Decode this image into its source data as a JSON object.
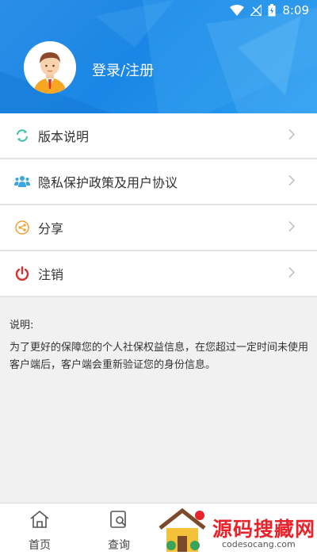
{
  "status_bar": {
    "time": "8:09"
  },
  "header": {
    "login_label": "登录/注册"
  },
  "menu": [
    {
      "label": "版本说明",
      "icon": "refresh-icon",
      "color": "#3bbfa6"
    },
    {
      "label": "隐私保护政策及用户协议",
      "icon": "users-icon",
      "color": "#3ba6e0"
    },
    {
      "label": "分享",
      "icon": "share-icon",
      "color": "#f0a030"
    },
    {
      "label": "注销",
      "icon": "power-icon",
      "color": "#d8302a"
    }
  ],
  "note": {
    "title": "说明:",
    "body": "为了更好的保障您的个人社保权益信息，在您超过一定时间未使用客户端后，客户端会重新验证您的身份信息。"
  },
  "tabbar": [
    {
      "label": "首页",
      "icon": "home-icon"
    },
    {
      "label": "查询",
      "icon": "search-doc-icon"
    }
  ],
  "watermark": {
    "title": "源码搜藏网",
    "url": "codesocang.com"
  },
  "colors": {
    "primary": "#1a86e5",
    "background": "#f1f1f1"
  }
}
